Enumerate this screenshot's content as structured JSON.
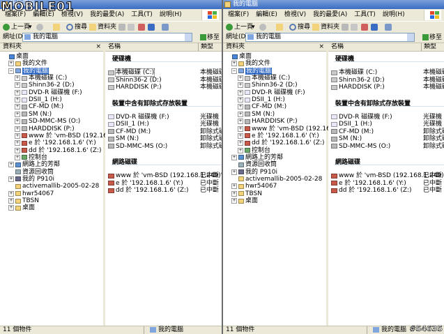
{
  "windows": [
    {
      "title": "我的電腦",
      "menu": [
        "檔案(F)",
        "編輯(E)",
        "檢視(V)",
        "我的最愛(A)",
        "工具(T)",
        "說明(H)"
      ],
      "toolbar": {
        "back": "上一頁",
        "search": "搜尋",
        "folders": "資料夾"
      },
      "address": {
        "label": "網址(D)",
        "value": "我的電腦",
        "go": "移至"
      },
      "folders_pane": {
        "title": "資料夾",
        "close": "×"
      },
      "columns": {
        "name": "名稱",
        "type": "類型"
      },
      "tree": [
        {
          "label": "桌面",
          "icon": "desktop-icon",
          "depth": 0,
          "expander": ""
        },
        {
          "label": "我的文件",
          "icon": "folder-icon",
          "depth": 1,
          "expander": "+"
        },
        {
          "label": "我的電腦",
          "icon": "computer-icon",
          "depth": 1,
          "expander": "−",
          "selected": true
        },
        {
          "label": "本機磁碟 (C:)",
          "icon": "drive-icon",
          "depth": 2,
          "expander": "+"
        },
        {
          "label": "Shinn36-2 (D:)",
          "icon": "drive-icon",
          "depth": 2,
          "expander": "+"
        },
        {
          "label": "DVD-R 磁碟機 (F:)",
          "icon": "cd-drive-icon",
          "depth": 2,
          "expander": "+"
        },
        {
          "label": "DSII_1 (H:)",
          "icon": "cd-drive-icon",
          "depth": 2,
          "expander": "+"
        },
        {
          "label": "CF-MD (M:)",
          "icon": "removable-drive-icon",
          "depth": 2,
          "expander": "+"
        },
        {
          "label": "SM (N:)",
          "icon": "removable-drive-icon",
          "depth": 2,
          "expander": "+"
        },
        {
          "label": "SD-MMC-MS (O:)",
          "icon": "removable-drive-icon",
          "depth": 2,
          "expander": "+"
        },
        {
          "label": "HARDDISK (P:)",
          "icon": "removable-drive-icon",
          "depth": 2,
          "expander": "+"
        },
        {
          "label": "www 於 'vm-BSD (192.168.1.249)'",
          "icon": "network-drive-icon",
          "depth": 2,
          "expander": "+"
        },
        {
          "label": "e 於 '192.168.1.6' (Y:)",
          "icon": "network-drive-icon",
          "depth": 2,
          "expander": "+"
        },
        {
          "label": "dd 於 '192.168.1.6' (Z:)",
          "icon": "network-drive-icon",
          "depth": 2,
          "expander": "+"
        },
        {
          "label": "控制台",
          "icon": "control-panel-icon",
          "depth": 2,
          "expander": "+"
        },
        {
          "label": "網路上的芳鄰",
          "icon": "network-icon",
          "depth": 1,
          "expander": "+"
        },
        {
          "label": "資源回收筒",
          "icon": "recycle-bin-icon",
          "depth": 1,
          "expander": ""
        },
        {
          "label": "我的 P910i",
          "icon": "phone-icon",
          "depth": 1,
          "expander": "+"
        },
        {
          "label": "activemallib-2005-02-28",
          "icon": "folder-icon",
          "depth": 1,
          "expander": ""
        },
        {
          "label": "hwr54067",
          "icon": "folder-icon",
          "depth": 1,
          "expander": "+"
        },
        {
          "label": "TBSN",
          "icon": "folder-icon",
          "depth": 1,
          "expander": "+"
        },
        {
          "label": "桌面",
          "icon": "folder-icon",
          "depth": 1,
          "expander": "+"
        }
      ],
      "groups": [
        {
          "title": "硬碟機",
          "items": [
            {
              "name": "本機磁碟 (C:)",
              "type": "本機磁碟",
              "icon": "drive-icon",
              "selected": true
            },
            {
              "name": "Shinn36-2 (D:)",
              "type": "本機磁碟",
              "icon": "drive-icon"
            },
            {
              "name": "HARDDISK (P:)",
              "type": "本機磁碟",
              "icon": "drive-icon"
            }
          ]
        },
        {
          "title": "裝置中含有卸除式存放裝置",
          "items": [
            {
              "name": "DVD-R 磁碟機 (F:)",
              "type": "光碟機",
              "icon": "cd-drive-icon"
            },
            {
              "name": "DSII_1 (H:)",
              "type": "光碟機",
              "icon": "cd-drive-icon"
            },
            {
              "name": "CF-MD (M:)",
              "type": "卸除式磁",
              "icon": "removable-drive-icon"
            },
            {
              "name": "SM (N:)",
              "type": "卸除式磁",
              "icon": "removable-drive-icon"
            },
            {
              "name": "SD-MMC-MS (O:)",
              "type": "卸除式磁",
              "icon": "removable-drive-icon"
            }
          ]
        },
        {
          "title": "網路磁碟",
          "items": [
            {
              "name": "www 於 'vm-BSD (192.168.1.249)' (X:)",
              "type": "已中斷",
              "icon": "network-drive-icon"
            },
            {
              "name": "e 於 '192.168.1.6' (Y:)",
              "type": "已中斷",
              "icon": "network-drive-icon"
            },
            {
              "name": "dd 於 '192.168.1.6' (Z:)",
              "type": "已中斷",
              "icon": "network-drive-icon"
            }
          ]
        }
      ],
      "status": {
        "count": "11 個物件",
        "location": "我的電腦"
      }
    },
    {
      "title": "我的電腦",
      "menu": [
        "檔案(F)",
        "編輯(E)",
        "檢視(V)",
        "我的最愛(A)",
        "工具(T)",
        "說明(H)"
      ],
      "toolbar": {
        "back": "上一頁",
        "search": "搜尋",
        "folders": "資料夾"
      },
      "address": {
        "label": "網址(D)",
        "value": "我的電腦",
        "go": "移至"
      },
      "folders_pane": {
        "title": "資料夾",
        "close": "×"
      },
      "columns": {
        "name": "名稱",
        "type": "類型"
      },
      "tree": [
        {
          "label": "桌面",
          "icon": "desktop-icon",
          "depth": 0,
          "expander": ""
        },
        {
          "label": "我的文件",
          "icon": "folder-icon",
          "depth": 1,
          "expander": "+"
        },
        {
          "label": "我的電腦",
          "icon": "computer-icon",
          "depth": 1,
          "expander": "−",
          "selected": true
        },
        {
          "label": "本機磁碟 (C:)",
          "icon": "drive-icon",
          "depth": 2,
          "expander": "+"
        },
        {
          "label": "Shinn36-2 (D:)",
          "icon": "drive-icon",
          "depth": 2,
          "expander": "+"
        },
        {
          "label": "DVD-R 磁碟機 (F:)",
          "icon": "cd-drive-icon",
          "depth": 2,
          "expander": "+"
        },
        {
          "label": "DSII_1 (H:)",
          "icon": "cd-drive-icon",
          "depth": 2,
          "expander": "+"
        },
        {
          "label": "CF-MD (M:)",
          "icon": "removable-drive-icon",
          "depth": 2,
          "expander": "+"
        },
        {
          "label": "SM (N:)",
          "icon": "removable-drive-icon",
          "depth": 2,
          "expander": "+"
        },
        {
          "label": "HARDDISK (P:)",
          "icon": "removable-drive-icon",
          "depth": 2,
          "expander": "+"
        },
        {
          "label": "www 於 'vm-BSD (192.168.1.249)'",
          "icon": "network-drive-icon",
          "depth": 2,
          "expander": "+"
        },
        {
          "label": "e 於 '192.168.1.6' (Y:)",
          "icon": "network-drive-icon",
          "depth": 2,
          "expander": "+"
        },
        {
          "label": "dd 於 '192.168.1.6' (Z:)",
          "icon": "network-drive-icon",
          "depth": 2,
          "expander": "+"
        },
        {
          "label": "控制台",
          "icon": "control-panel-icon",
          "depth": 2,
          "expander": "+"
        },
        {
          "label": "網路上的芳鄰",
          "icon": "network-icon",
          "depth": 1,
          "expander": "+"
        },
        {
          "label": "資源回收筒",
          "icon": "recycle-bin-icon",
          "depth": 1,
          "expander": ""
        },
        {
          "label": "我的 P910i",
          "icon": "phone-icon",
          "depth": 1,
          "expander": "+"
        },
        {
          "label": "activemallib-2005-02-28",
          "icon": "folder-icon",
          "depth": 1,
          "expander": ""
        },
        {
          "label": "hwr54067",
          "icon": "folder-icon",
          "depth": 1,
          "expander": "+"
        },
        {
          "label": "TBSN",
          "icon": "folder-icon",
          "depth": 1,
          "expander": "+"
        },
        {
          "label": "桌面",
          "icon": "folder-icon",
          "depth": 1,
          "expander": "+"
        }
      ],
      "groups": [
        {
          "title": "硬碟機",
          "items": [
            {
              "name": "本機磁碟 (C:)",
              "type": "本機磁碟",
              "icon": "drive-icon"
            },
            {
              "name": "Shinn36-2 (D:)",
              "type": "本機磁碟",
              "icon": "drive-icon"
            },
            {
              "name": "HARDDISK (P:)",
              "type": "本機磁碟",
              "icon": "drive-icon"
            }
          ]
        },
        {
          "title": "裝置中含有卸除式存放裝置",
          "items": [
            {
              "name": "DVD-R 磁碟機 (F:)",
              "type": "光碟機",
              "icon": "cd-drive-icon"
            },
            {
              "name": "DSII_1 (H:)",
              "type": "光碟機",
              "icon": "cd-drive-icon"
            },
            {
              "name": "CF-MD (M:)",
              "type": "卸除式磁",
              "icon": "removable-drive-icon"
            },
            {
              "name": "SM (N:)",
              "type": "卸除式磁",
              "icon": "removable-drive-icon"
            },
            {
              "name": "SD-MMC-MS (O:)",
              "type": "卸除式磁",
              "icon": "removable-drive-icon"
            }
          ]
        },
        {
          "title": "網路磁碟",
          "items": [
            {
              "name": "www 於 'vm-BSD (192.168.1.249)' (X:)",
              "type": "已中斷",
              "icon": "network-drive-icon"
            },
            {
              "name": "e 於 '192.168.1.6' (Y:)",
              "type": "已中斷",
              "icon": "network-drive-icon"
            },
            {
              "name": "dd 於 '192.168.1.6' (Z:)",
              "type": "已中斷",
              "icon": "network-drive-icon"
            }
          ]
        }
      ],
      "status": {
        "count": "11 個物件",
        "location": "我的電腦"
      }
    }
  ],
  "overlay": {
    "logo": "MOBILE01",
    "watermark": "#54635"
  },
  "colors": {
    "title_bar": "#3a6cc4",
    "chrome": "#ece9d8",
    "selection": "#316ac5"
  }
}
